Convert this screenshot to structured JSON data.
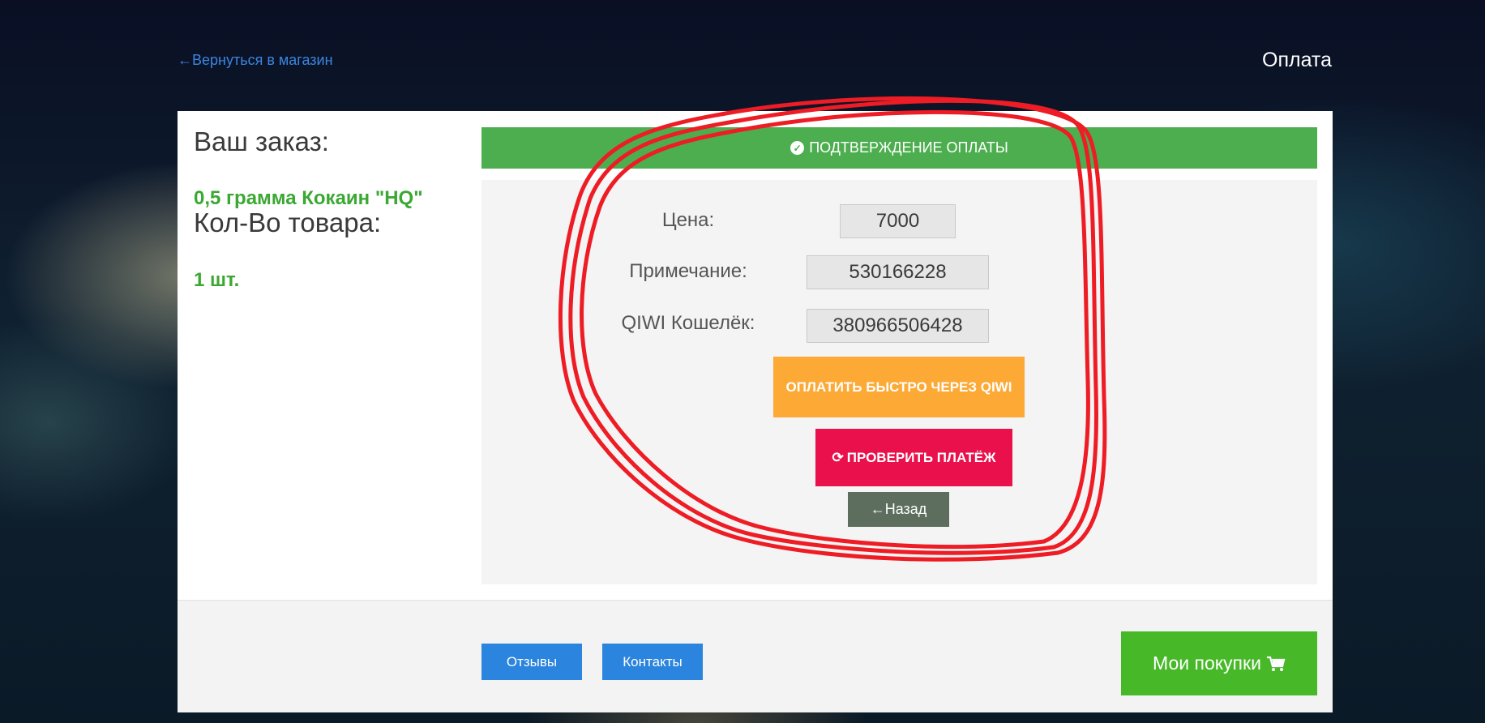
{
  "header": {
    "back_link": "←Вернуться в магазин",
    "title": "Оплата"
  },
  "order": {
    "order_label": "Ваш заказ:",
    "product": "0,5 грамма Кокаин \"HQ\"",
    "qty_label": "Кол-Во товара:",
    "qty_value": "1 шт."
  },
  "payment": {
    "header": "ПОДТВЕРЖДЕНИЕ ОПЛАТЫ",
    "fields": [
      {
        "label": "Цена:",
        "value": "7000"
      },
      {
        "label": "Примечание:",
        "value": "530166228"
      },
      {
        "label": "QIWI Кошелёк:",
        "value": "380966506428"
      }
    ],
    "pay_qiwi_button": "ОПЛАТИТЬ БЫСТРО ЧЕРЕЗ QIWI",
    "check_payment_button": "ПРОВЕРИТЬ ПЛАТЁЖ",
    "back_button": "←Назад"
  },
  "footer": {
    "reviews_button": "Отзывы",
    "contacts_button": "Контакты",
    "purchases_button": "Мои покупки"
  },
  "icons": {
    "confirm": "check-circle-icon",
    "refresh": "refresh-icon",
    "cart": "cart-icon"
  },
  "colors": {
    "confirm_green": "#4cae4f",
    "qiwi_orange": "#fda936",
    "check_red": "#e9104c",
    "link_blue": "#2b84dd",
    "purchases_green": "#47b929",
    "annotation_red": "#ee1c24"
  }
}
